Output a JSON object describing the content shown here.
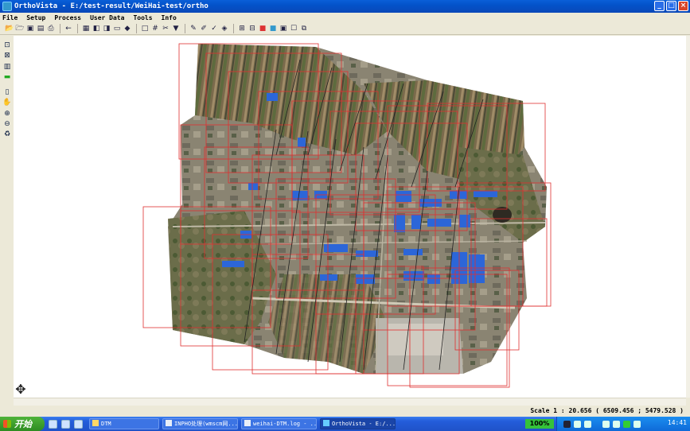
{
  "window": {
    "title": "OrthoVista - E:/test-result/WeiHai-test/ortho",
    "buttons": [
      "_",
      "□",
      "×"
    ]
  },
  "menu": {
    "items": [
      "File",
      "Setup",
      "Process",
      "User Data",
      "Tools",
      "Info"
    ]
  },
  "toolbar": {
    "icons": [
      "open-folder-icon",
      "open-file-icon",
      "save-icon",
      "save-all-icon",
      "print-icon",
      "back-arrow-icon",
      "mosaic-icon",
      "layer-icon",
      "layer2-icon",
      "frame-icon",
      "diamond-icon",
      "select-rect-icon",
      "grid-icon",
      "cut-icon",
      "paint-icon",
      "edit-icon",
      "pen-icon",
      "pick-icon",
      "fill-icon",
      "tile-icon",
      "multi-tile-icon",
      "color-icon",
      "blend-icon",
      "image-icon",
      "window-icon",
      "copy-icon"
    ]
  },
  "left_palette": {
    "icons": [
      "fit-view-icon",
      "zoom-window-icon",
      "layer-list-icon",
      "flag-icon",
      "page-icon",
      "pan-hand-icon",
      "zoom-in-icon",
      "zoom-out-icon",
      "trash-icon"
    ]
  },
  "status": {
    "scale": "Scale 1 : 20.656  ( 6509.456 ; 5479.528 )"
  },
  "taskbar": {
    "start_label": "开始",
    "tasks": [
      "DTM",
      "INPHO处理(wmscm网...",
      "weihai-DTM.log - ...",
      "OrthoVista - E:/..."
    ],
    "zoom": "100%",
    "clock": "14:41"
  },
  "canvas": {
    "footprint_color": "#e03030",
    "background": "#ffffff"
  }
}
